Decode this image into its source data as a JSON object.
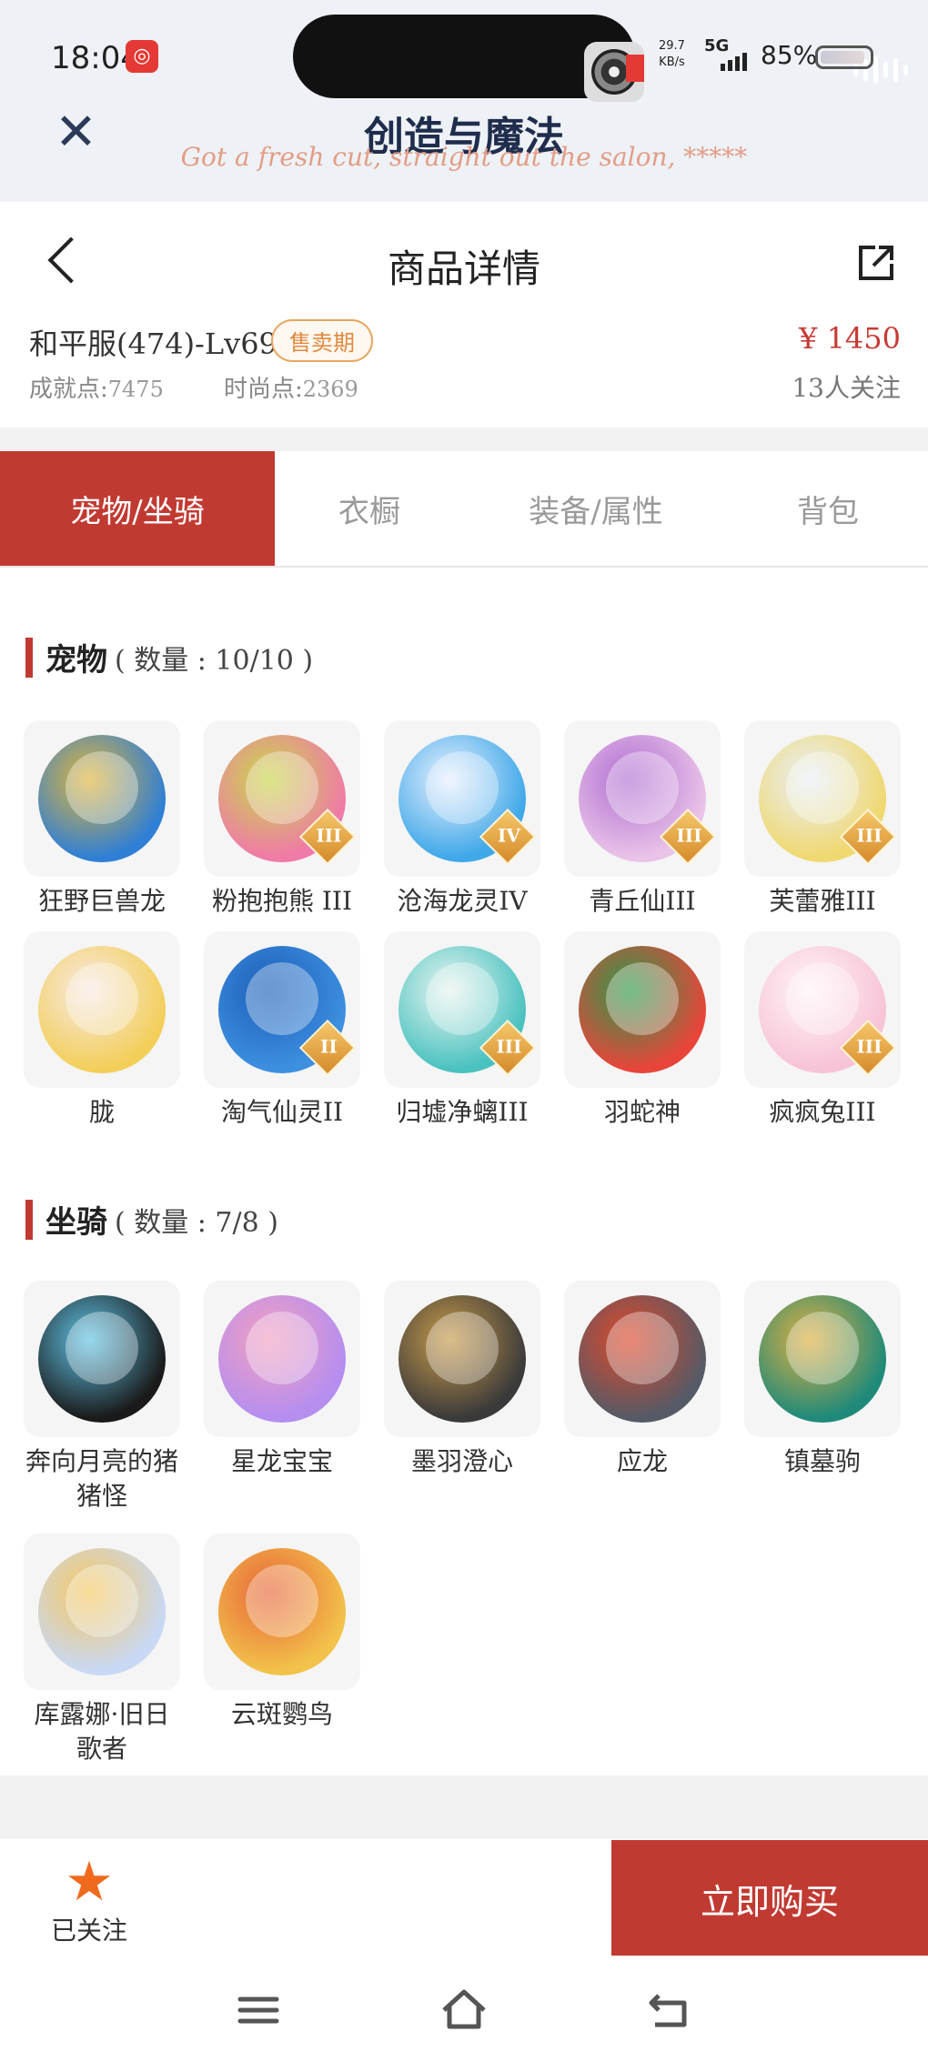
{
  "status_bar": {
    "time": "18:04",
    "net_speed_value": "29.7",
    "net_speed_unit": "KB/s",
    "network": "5G",
    "battery": "85%"
  },
  "app_header": {
    "title": "创造与魔法",
    "subtitle": "Got a fresh cut, straight out the salon, *****"
  },
  "nav": {
    "title": "商品详情"
  },
  "product": {
    "server": "和平服(474)-Lv69",
    "badge": "售卖期",
    "price": "¥ 1450",
    "achievement_label": "成就点:",
    "achievement_value": "7475",
    "fashion_label": "时尚点:",
    "fashion_value": "2369",
    "followers": "13人关注"
  },
  "tabs": [
    {
      "label": "宠物/坐骑",
      "active": true
    },
    {
      "label": "衣橱",
      "active": false
    },
    {
      "label": "装备/属性",
      "active": false
    },
    {
      "label": "背包",
      "active": false
    }
  ],
  "pets": {
    "title": "宠物",
    "count": "( 数量 : 10/10 )",
    "items": [
      {
        "name": "狂野巨兽龙",
        "tier": "",
        "colors": [
          "#2f7fd6",
          "#e0b53a"
        ]
      },
      {
        "name": "粉抱抱熊 III",
        "tier": "III",
        "colors": [
          "#f07aa8",
          "#c8d84a"
        ]
      },
      {
        "name": "沧海龙灵IV",
        "tier": "IV",
        "colors": [
          "#3fa8e8",
          "#e8f0ff"
        ]
      },
      {
        "name": "青丘仙III",
        "tier": "III",
        "colors": [
          "#e9c3e8",
          "#b06fd2"
        ]
      },
      {
        "name": "芙蕾雅III",
        "tier": "III",
        "colors": [
          "#f0d870",
          "#e8f0f8"
        ]
      },
      {
        "name": "胧",
        "tier": "",
        "colors": [
          "#f3cf5a",
          "#f7e9e4"
        ]
      },
      {
        "name": "淘气仙灵II",
        "tier": "II",
        "colors": [
          "#3d8fe0",
          "#1d5fb8"
        ]
      },
      {
        "name": "归墟净螭III",
        "tier": "III",
        "colors": [
          "#4ac2c0",
          "#e8f5f0"
        ]
      },
      {
        "name": "羽蛇神",
        "tier": "",
        "colors": [
          "#e8453a",
          "#2a9a4a"
        ]
      },
      {
        "name": "疯疯兔III",
        "tier": "III",
        "colors": [
          "#f7c3d6",
          "#fff4f8"
        ]
      }
    ]
  },
  "mounts": {
    "title": "坐骑",
    "count": "( 数量 : 7/8 )",
    "items": [
      {
        "name": "奔向月亮的猪猪怪",
        "tier": "",
        "colors": [
          "#1a1a1a",
          "#5fc3e6"
        ]
      },
      {
        "name": "星龙宝宝",
        "tier": "",
        "colors": [
          "#b58ef0",
          "#f2a0c0"
        ]
      },
      {
        "name": "墨羽澄心",
        "tier": "",
        "colors": [
          "#3a3a3a",
          "#c89a4a"
        ]
      },
      {
        "name": "应龙",
        "tier": "",
        "colors": [
          "#555a66",
          "#e0482a"
        ]
      },
      {
        "name": "镇墓驹",
        "tier": "",
        "colors": [
          "#1f8a7a",
          "#e0b040"
        ]
      },
      {
        "name": "库露娜·旧日歌者",
        "tier": "",
        "colors": [
          "#c8d8f5",
          "#f6c860"
        ]
      },
      {
        "name": "云斑鹦鸟",
        "tier": "",
        "colors": [
          "#f2c24a",
          "#e8653a"
        ]
      }
    ]
  },
  "bottom": {
    "follow_label": "已关注",
    "buy_label": "立即购买"
  },
  "icons": {
    "close": "close-icon",
    "back": "back-arrow-icon",
    "share": "share-icon",
    "star": "star-icon",
    "menu": "menu-icon",
    "home": "home-icon",
    "return": "return-icon"
  },
  "colors": {
    "brand_red": "#c13a32",
    "price_red": "#c63b35",
    "star_orange": "#f06a1e",
    "badge_orange": "#e08a40"
  }
}
